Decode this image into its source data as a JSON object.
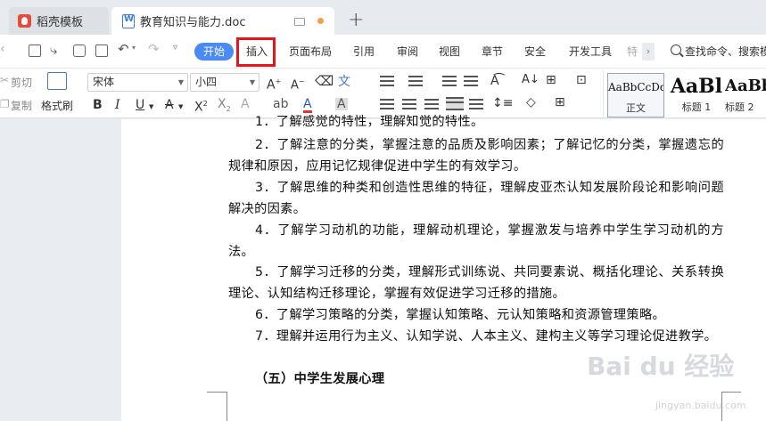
{
  "tabs": [
    {
      "label": "稻壳模板"
    },
    {
      "label": "教育知识与能力.doc"
    }
  ],
  "menu": {
    "start": "开始",
    "insert": "插入",
    "layout": "页面布局",
    "reference": "引用",
    "review": "审阅",
    "view": "视图",
    "chapter": "章节",
    "security": "安全",
    "devtools": "开发工具",
    "more": "特",
    "search_placeholder": "查找命令、搜索模板"
  },
  "toolbar": {
    "cut": "剪切",
    "copy": "复制",
    "format_painter": "格式刷",
    "font_name": "宋体",
    "font_size": "小四",
    "styles": [
      {
        "sample": "AaBbCcDd",
        "name": "正文"
      },
      {
        "sample": "AaBl",
        "name": "标题 1"
      },
      {
        "sample": "AaBb",
        "name": "标题 2"
      }
    ]
  },
  "document": {
    "partial_top": "1．了解感觉的特性，理解知觉的特性。",
    "paragraphs": [
      "2．了解注意的分类，掌握注意的品质及影响因素；了解记忆的分类，掌握遗忘的规律和原因，应用记忆规律促进中学生的有效学习。",
      "3．了解思维的种类和创造性思维的特征，理解皮亚杰认知发展阶段论和影响问题解决的因素。",
      "4．了解学习动机的功能，理解动机理论，掌握激发与培养中学生学习动机的方法。",
      "5．了解学习迁移的分类，理解形式训练说、共同要素说、概括化理论、关系转换理论、认知结构迁移理论，掌握有效促进学习迁移的措施。",
      "6．了解学习策略的分类，掌握认知策略、元认知策略和资源管理策略。",
      "7．理解并运用行为主义、认知学说、人本主义、建构主义等学习理论促进教学。"
    ],
    "heading": "（五）中学生发展心理"
  },
  "watermark": {
    "text": "Bai du 经验",
    "sub": "jingyan.baidu.com"
  }
}
